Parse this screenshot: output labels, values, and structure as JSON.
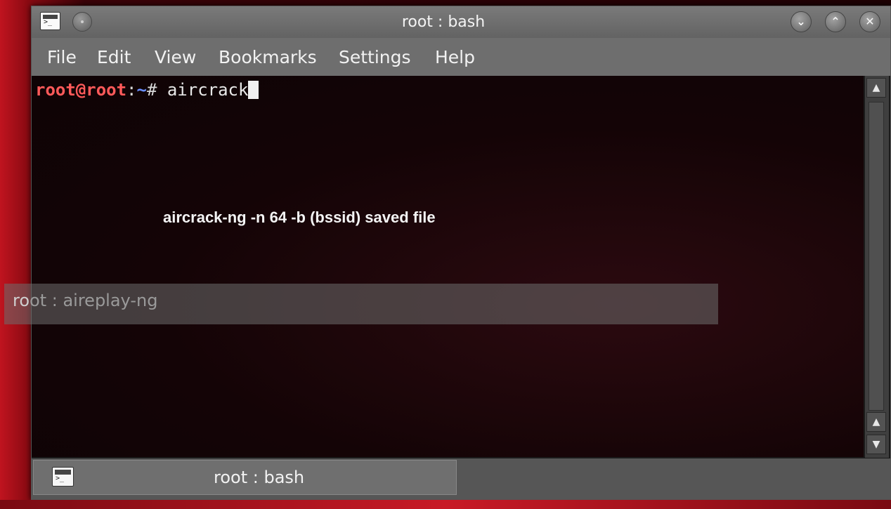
{
  "window": {
    "title": "root : bash",
    "buttons": {
      "minimize": "⌄",
      "maximize": "⌃",
      "close": "✕"
    }
  },
  "menu": {
    "items": [
      "File",
      "Edit",
      "View",
      "Bookmarks",
      "Settings",
      "Help"
    ]
  },
  "terminal": {
    "prompt_user": "root@root",
    "prompt_sep": ":",
    "prompt_path": "~",
    "prompt_hash": "# ",
    "command": "aircrack"
  },
  "overlay_caption": "aircrack-ng -n 64 -b (bssid) saved file",
  "background_window": {
    "title_first": "ro",
    "title_rest": "ot : aireplay-ng"
  },
  "scrollbar": {
    "up": "▲",
    "down": "▼"
  },
  "tabbar": {
    "tabs": [
      {
        "label": "root : bash",
        "icon": "terminal-icon"
      }
    ]
  },
  "colors": {
    "prompt_user": "#ff5a5a",
    "prompt_path": "#6a8fff",
    "desktop_accent": "#c0141f"
  }
}
